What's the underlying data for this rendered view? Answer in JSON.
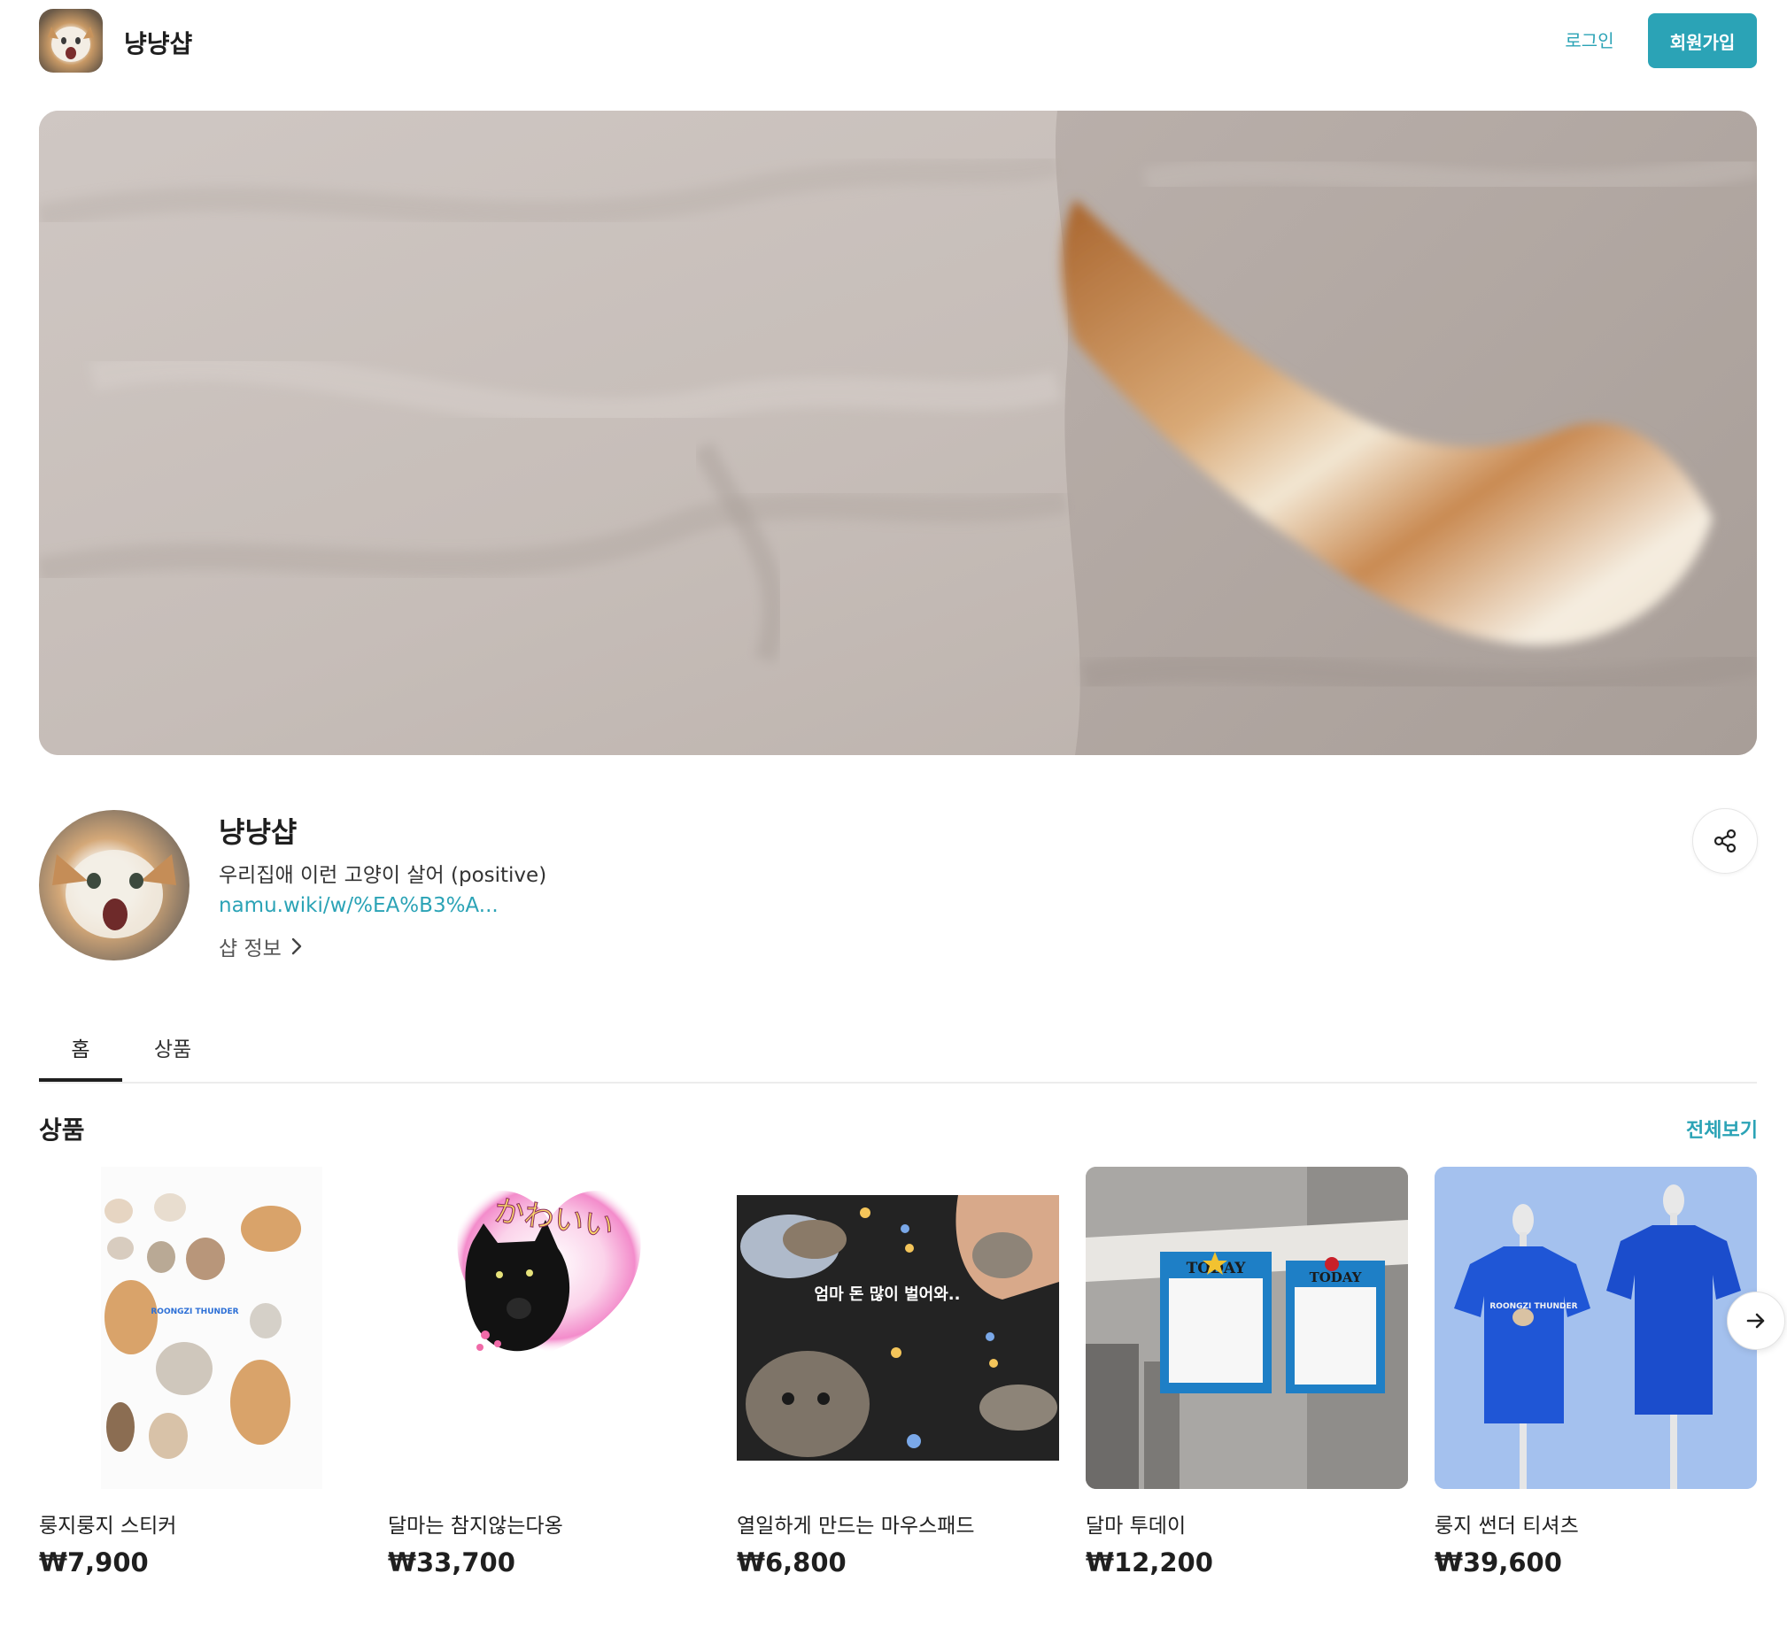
{
  "header": {
    "shop_name": "냥냥샵",
    "login_label": "로그인",
    "signup_label": "회원가입"
  },
  "profile": {
    "name": "냥냥샵",
    "description": "우리집애 이런 고양이 살어 (positive)",
    "link": "namu.wiki/w/%EA%B3%A...",
    "shop_info_label": "샵 정보"
  },
  "tabs": [
    {
      "label": "홈",
      "active": true
    },
    {
      "label": "상품",
      "active": false
    }
  ],
  "products_section": {
    "title": "상품",
    "see_all_label": "전체보기",
    "items": [
      {
        "name": "룽지룽지 스티커",
        "price": "₩7,900"
      },
      {
        "name": "달마는 참지않는다옹",
        "price": "₩33,700"
      },
      {
        "name": "열일하게 만드는 마우스패드",
        "price": "₩6,800"
      },
      {
        "name": "달마 투데이",
        "price": "₩12,200"
      },
      {
        "name": "룽지 썬더 티셔츠",
        "price": "₩39,600"
      }
    ]
  },
  "image_text": {
    "kawaii": "かわいい",
    "mousepad_caption": "엄마 돈 많이 벌어와..",
    "today_1": "TODAY",
    "today_2": "TODAY",
    "sticker_logo": "ROONGZI THUNDER",
    "tshirt_logo": "ROONGZI THUNDER"
  },
  "colors": {
    "accent": "#2ba3b6",
    "text": "#1f1f1f",
    "tshirt_blue": "#1f56d6"
  },
  "icons": {
    "share": "share-icon",
    "chevron": "chevron-right-icon",
    "next": "arrow-right-icon"
  }
}
